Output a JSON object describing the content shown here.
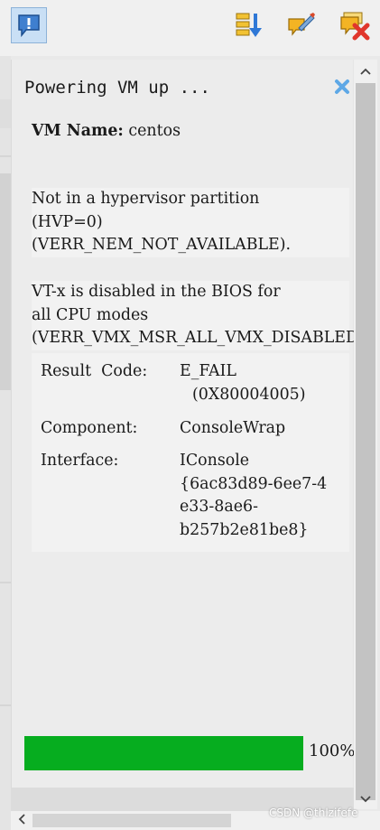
{
  "toolbar": {
    "buttons": [
      {
        "icon": "notification-icon",
        "active": true
      },
      {
        "icon": "sort-order-icon"
      },
      {
        "icon": "accept-all-icon"
      },
      {
        "icon": "close-all-icon"
      }
    ]
  },
  "notification": {
    "title": "Powering VM up ...",
    "vm_name_label": "VM Name:",
    "vm_name_value": "centos",
    "error1_lines": [
      "Not in a hypervisor partition",
      "(HVP=0)",
      "(VERR_NEM_NOT_AVAILABLE)."
    ],
    "error2_lines": [
      "VT-x is disabled in the BIOS for",
      "all CPU modes",
      "(VERR_VMX_MSR_ALL_VMX_DISABLED)."
    ],
    "details": {
      "result_code_label": "Result  Code:",
      "result_code_value_lines": [
        "E_FAIL",
        "(0X80004005)"
      ],
      "component_label": "Component:",
      "component_value": "ConsoleWrap",
      "interface_label": "Interface:",
      "interface_value_lines": [
        "IConsole",
        "{6ac83d89-6ee7-4",
        "e33-8ae6-",
        "b257b2e81be8}"
      ]
    },
    "progress_percent": 100,
    "progress_label": "100%"
  },
  "colors": {
    "progress_fill": "#06ad1f",
    "close_icon": "#5ea8e6"
  },
  "watermark": "CSDN @thlzifefe"
}
